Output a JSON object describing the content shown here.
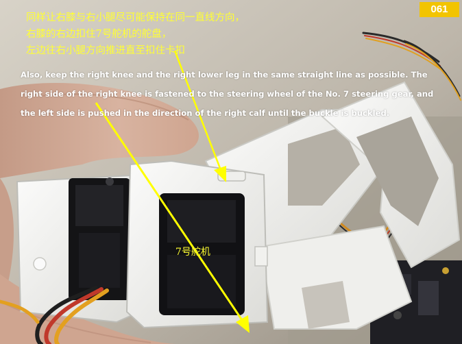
{
  "page_number": "061",
  "instructions_zh": [
    "同样让右膝与右小腿尽可能保持在同一直线方向，",
    "右膝的右边扣住7号舵机的舵盘，",
    "左边往右小腿方向推进直至扣住卡扣"
  ],
  "instructions_en": "Also, keep the right knee and the right lower leg in the same straight line as possible. The right side of the right knee is fastened to the steering wheel of the No. 7 steering gear, and the left side is pushed in the direction of the right calf until the buckle is buckled.",
  "servo_label": "7号舵机",
  "colors": {
    "badge": "#f2c400",
    "caption_yellow": "#ffff33",
    "arrow": "#ffff00",
    "part_white": "#f3f3f1"
  }
}
